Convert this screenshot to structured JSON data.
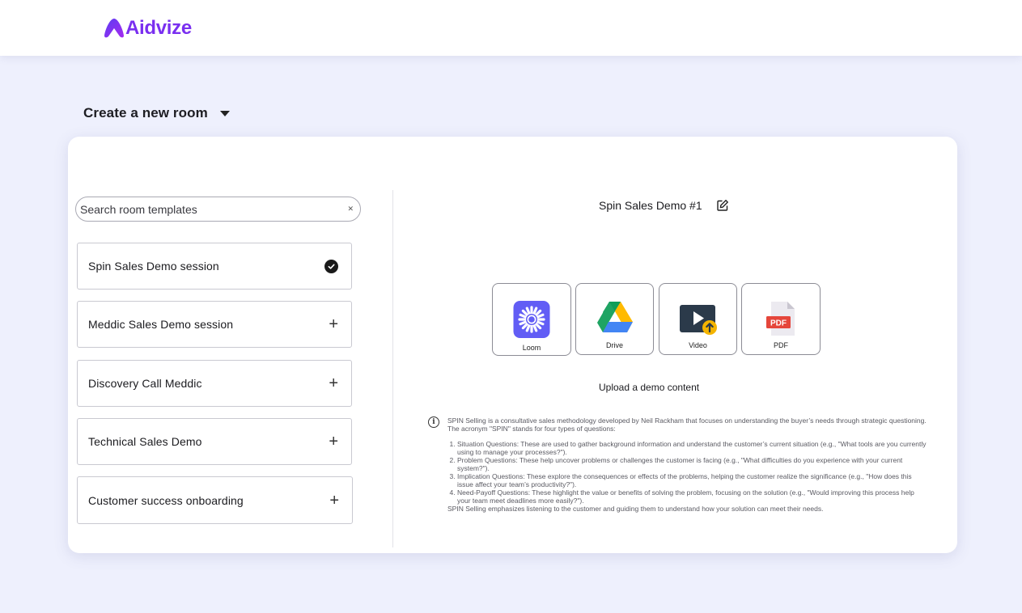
{
  "brand": {
    "name": "Aidvize",
    "color": "#7a2ff0"
  },
  "header": {
    "title": "Create a new room",
    "dropdown_icon": "caret-down-icon"
  },
  "search": {
    "placeholder": "Search room templates",
    "value": "",
    "clear_icon": "close-icon"
  },
  "templates": [
    {
      "label": "Spin Sales Demo session",
      "state": "selected",
      "icon": "check-circle-icon"
    },
    {
      "label": "Meddic Sales Demo session",
      "state": "add",
      "icon": "plus-icon"
    },
    {
      "label": "Discovery Call Meddic",
      "state": "add",
      "icon": "plus-icon"
    },
    {
      "label": "Technical Sales Demo",
      "state": "add",
      "icon": "plus-icon"
    },
    {
      "label": "Customer success onboarding",
      "state": "add",
      "icon": "plus-icon"
    }
  ],
  "plus_symbol": "+",
  "demo": {
    "title": "Spin Sales Demo #1",
    "edit_icon": "edit-icon",
    "sources": [
      {
        "label": "Loom",
        "icon": "loom-icon",
        "color": "#625df5"
      },
      {
        "label": "Drive",
        "icon": "google-drive-icon",
        "color": "#1fa463"
      },
      {
        "label": "Video",
        "icon": "video-upload-icon",
        "color": "#2b3a4a"
      },
      {
        "label": "PDF",
        "icon": "pdf-file-icon",
        "color": "#e5463b",
        "badge": "PDF"
      }
    ],
    "upload_label": "Upload a demo content"
  },
  "info": {
    "icon": "info-icon",
    "intro": "SPIN Selling is a consultative sales methodology developed by Neil Rackham that focuses on understanding the buyer’s needs through strategic questioning. The acronym \"SPIN\" stands for four types of questions:",
    "items": [
      "Situation Questions: These are used to gather background information and understand the customer’s current situation (e.g., \"What tools are you currently using to manage your processes?\").",
      "Problem Questions: These help uncover problems or challenges the customer is facing (e.g., \"What difficulties do you experience with your current system?\").",
      "Implication Questions: These explore the consequences or effects of the problems, helping the customer realize the significance (e.g., \"How does this issue affect your team’s productivity?\").",
      "Need-Payoff Questions: These highlight the value or benefits of solving the problem, focusing on the solution (e.g., \"Would improving this process help your team meet deadlines more easily?\")."
    ],
    "outro": "SPIN Selling emphasizes listening to the customer and guiding them to understand how your solution can meet their needs."
  }
}
